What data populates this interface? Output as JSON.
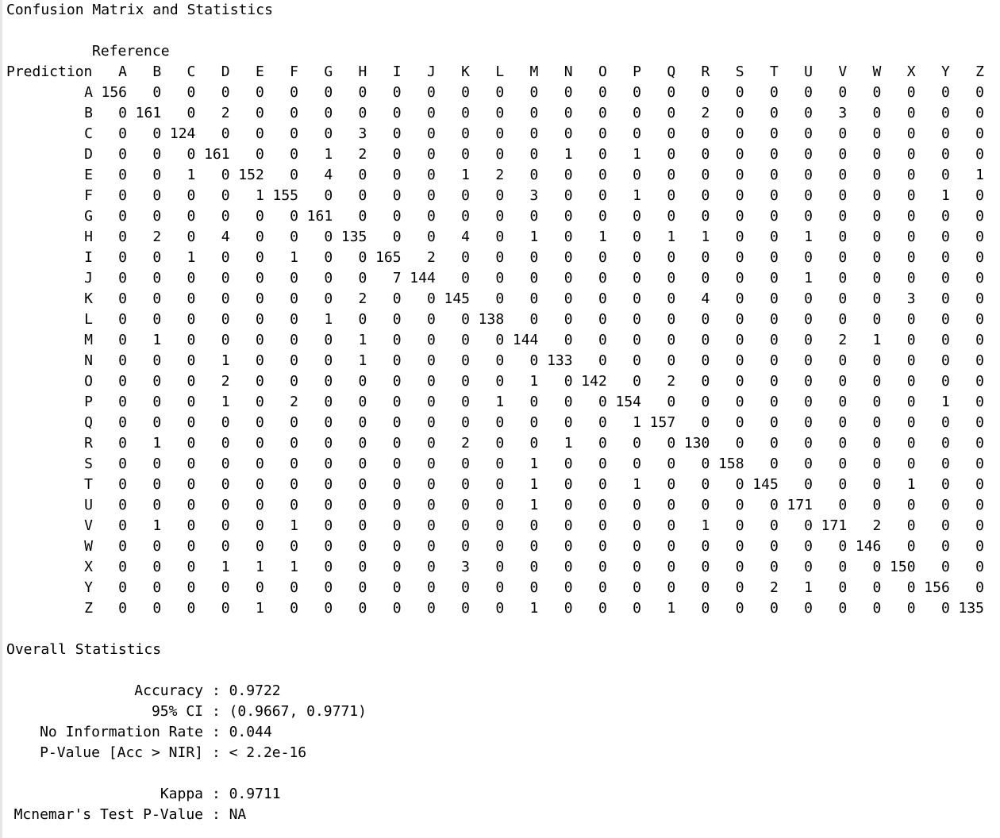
{
  "title": "Confusion Matrix and Statistics",
  "matrix": {
    "reference_label": "Reference",
    "prediction_label": "Prediction",
    "column_labels": [
      "A",
      "B",
      "C",
      "D",
      "E",
      "F",
      "G",
      "H",
      "I",
      "J",
      "K",
      "L",
      "M",
      "N",
      "O",
      "P",
      "Q",
      "R",
      "S",
      "T",
      "U",
      "V",
      "W",
      "X",
      "Y",
      "Z"
    ],
    "row_labels": [
      "A",
      "B",
      "C",
      "D",
      "E",
      "F",
      "G",
      "H",
      "I",
      "J",
      "K",
      "L",
      "M",
      "N",
      "O",
      "P",
      "Q",
      "R",
      "S",
      "T",
      "U",
      "V",
      "W",
      "X",
      "Y",
      "Z"
    ],
    "rows": [
      [
        156,
        0,
        0,
        0,
        0,
        0,
        0,
        0,
        0,
        0,
        0,
        0,
        0,
        0,
        0,
        0,
        0,
        0,
        0,
        0,
        0,
        0,
        0,
        0,
        0,
        0
      ],
      [
        0,
        161,
        0,
        2,
        0,
        0,
        0,
        0,
        0,
        0,
        0,
        0,
        0,
        0,
        0,
        0,
        0,
        2,
        0,
        0,
        0,
        3,
        0,
        0,
        0,
        0
      ],
      [
        0,
        0,
        124,
        0,
        0,
        0,
        0,
        3,
        0,
        0,
        0,
        0,
        0,
        0,
        0,
        0,
        0,
        0,
        0,
        0,
        0,
        0,
        0,
        0,
        0,
        0
      ],
      [
        0,
        0,
        0,
        161,
        0,
        0,
        1,
        2,
        0,
        0,
        0,
        0,
        0,
        1,
        0,
        1,
        0,
        0,
        0,
        0,
        0,
        0,
        0,
        0,
        0,
        0
      ],
      [
        0,
        0,
        1,
        0,
        152,
        0,
        4,
        0,
        0,
        0,
        1,
        2,
        0,
        0,
        0,
        0,
        0,
        0,
        0,
        0,
        0,
        0,
        0,
        0,
        0,
        1
      ],
      [
        0,
        0,
        0,
        0,
        1,
        155,
        0,
        0,
        0,
        0,
        0,
        0,
        3,
        0,
        0,
        1,
        0,
        0,
        0,
        0,
        0,
        0,
        0,
        0,
        1,
        0
      ],
      [
        0,
        0,
        0,
        0,
        0,
        0,
        161,
        0,
        0,
        0,
        0,
        0,
        0,
        0,
        0,
        0,
        0,
        0,
        0,
        0,
        0,
        0,
        0,
        0,
        0,
        0
      ],
      [
        0,
        2,
        0,
        4,
        0,
        0,
        0,
        135,
        0,
        0,
        4,
        0,
        1,
        0,
        1,
        0,
        1,
        1,
        0,
        0,
        1,
        0,
        0,
        0,
        0,
        0
      ],
      [
        0,
        0,
        1,
        0,
        0,
        1,
        0,
        0,
        165,
        2,
        0,
        0,
        0,
        0,
        0,
        0,
        0,
        0,
        0,
        0,
        0,
        0,
        0,
        0,
        0,
        0
      ],
      [
        0,
        0,
        0,
        0,
        0,
        0,
        0,
        0,
        7,
        144,
        0,
        0,
        0,
        0,
        0,
        0,
        0,
        0,
        0,
        0,
        1,
        0,
        0,
        0,
        0,
        0
      ],
      [
        0,
        0,
        0,
        0,
        0,
        0,
        0,
        2,
        0,
        0,
        145,
        0,
        0,
        0,
        0,
        0,
        0,
        4,
        0,
        0,
        0,
        0,
        0,
        3,
        0,
        0
      ],
      [
        0,
        0,
        0,
        0,
        0,
        0,
        1,
        0,
        0,
        0,
        0,
        138,
        0,
        0,
        0,
        0,
        0,
        0,
        0,
        0,
        0,
        0,
        0,
        0,
        0,
        0
      ],
      [
        0,
        1,
        0,
        0,
        0,
        0,
        0,
        1,
        0,
        0,
        0,
        0,
        144,
        0,
        0,
        0,
        0,
        0,
        0,
        0,
        0,
        2,
        1,
        0,
        0,
        0
      ],
      [
        0,
        0,
        0,
        1,
        0,
        0,
        0,
        1,
        0,
        0,
        0,
        0,
        0,
        133,
        0,
        0,
        0,
        0,
        0,
        0,
        0,
        0,
        0,
        0,
        0,
        0
      ],
      [
        0,
        0,
        0,
        2,
        0,
        0,
        0,
        0,
        0,
        0,
        0,
        0,
        1,
        0,
        142,
        0,
        2,
        0,
        0,
        0,
        0,
        0,
        0,
        0,
        0,
        0
      ],
      [
        0,
        0,
        0,
        1,
        0,
        2,
        0,
        0,
        0,
        0,
        0,
        1,
        0,
        0,
        0,
        154,
        0,
        0,
        0,
        0,
        0,
        0,
        0,
        0,
        1,
        0
      ],
      [
        0,
        0,
        0,
        0,
        0,
        0,
        0,
        0,
        0,
        0,
        0,
        0,
        0,
        0,
        0,
        1,
        157,
        0,
        0,
        0,
        0,
        0,
        0,
        0,
        0,
        0
      ],
      [
        0,
        1,
        0,
        0,
        0,
        0,
        0,
        0,
        0,
        0,
        2,
        0,
        0,
        1,
        0,
        0,
        0,
        130,
        0,
        0,
        0,
        0,
        0,
        0,
        0,
        0
      ],
      [
        0,
        0,
        0,
        0,
        0,
        0,
        0,
        0,
        0,
        0,
        0,
        0,
        1,
        0,
        0,
        0,
        0,
        0,
        158,
        0,
        0,
        0,
        0,
        0,
        0,
        0
      ],
      [
        0,
        0,
        0,
        0,
        0,
        0,
        0,
        0,
        0,
        0,
        0,
        0,
        1,
        0,
        0,
        1,
        0,
        0,
        0,
        145,
        0,
        0,
        0,
        1,
        0,
        0
      ],
      [
        0,
        0,
        0,
        0,
        0,
        0,
        0,
        0,
        0,
        0,
        0,
        0,
        1,
        0,
        0,
        0,
        0,
        0,
        0,
        0,
        171,
        0,
        0,
        0,
        0,
        0
      ],
      [
        0,
        1,
        0,
        0,
        0,
        1,
        0,
        0,
        0,
        0,
        0,
        0,
        0,
        0,
        0,
        0,
        0,
        1,
        0,
        0,
        0,
        171,
        2,
        0,
        0,
        0
      ],
      [
        0,
        0,
        0,
        0,
        0,
        0,
        0,
        0,
        0,
        0,
        0,
        0,
        0,
        0,
        0,
        0,
        0,
        0,
        0,
        0,
        0,
        0,
        146,
        0,
        0,
        0
      ],
      [
        0,
        0,
        0,
        1,
        1,
        1,
        0,
        0,
        0,
        0,
        3,
        0,
        0,
        0,
        0,
        0,
        0,
        0,
        0,
        0,
        0,
        0,
        0,
        150,
        0,
        0
      ],
      [
        0,
        0,
        0,
        0,
        0,
        0,
        0,
        0,
        0,
        0,
        0,
        0,
        0,
        0,
        0,
        0,
        0,
        0,
        0,
        2,
        1,
        0,
        0,
        0,
        156,
        0
      ],
      [
        0,
        0,
        0,
        0,
        1,
        0,
        0,
        0,
        0,
        0,
        0,
        0,
        1,
        0,
        0,
        0,
        1,
        0,
        0,
        0,
        0,
        0,
        0,
        0,
        0,
        135
      ]
    ]
  },
  "overall": {
    "heading": "Overall Statistics",
    "stats": [
      {
        "label": "Accuracy",
        "value": "0.9722"
      },
      {
        "label": "95% CI",
        "value": "(0.9667, 0.9771)"
      },
      {
        "label": "No Information Rate",
        "value": "0.044"
      },
      {
        "label": "P-Value [Acc > NIR]",
        "value": "< 2.2e-16"
      },
      {
        "label": "Kappa",
        "value": "0.9711"
      },
      {
        "label": "Mcnemar's Test P-Value",
        "value": "NA"
      }
    ]
  }
}
